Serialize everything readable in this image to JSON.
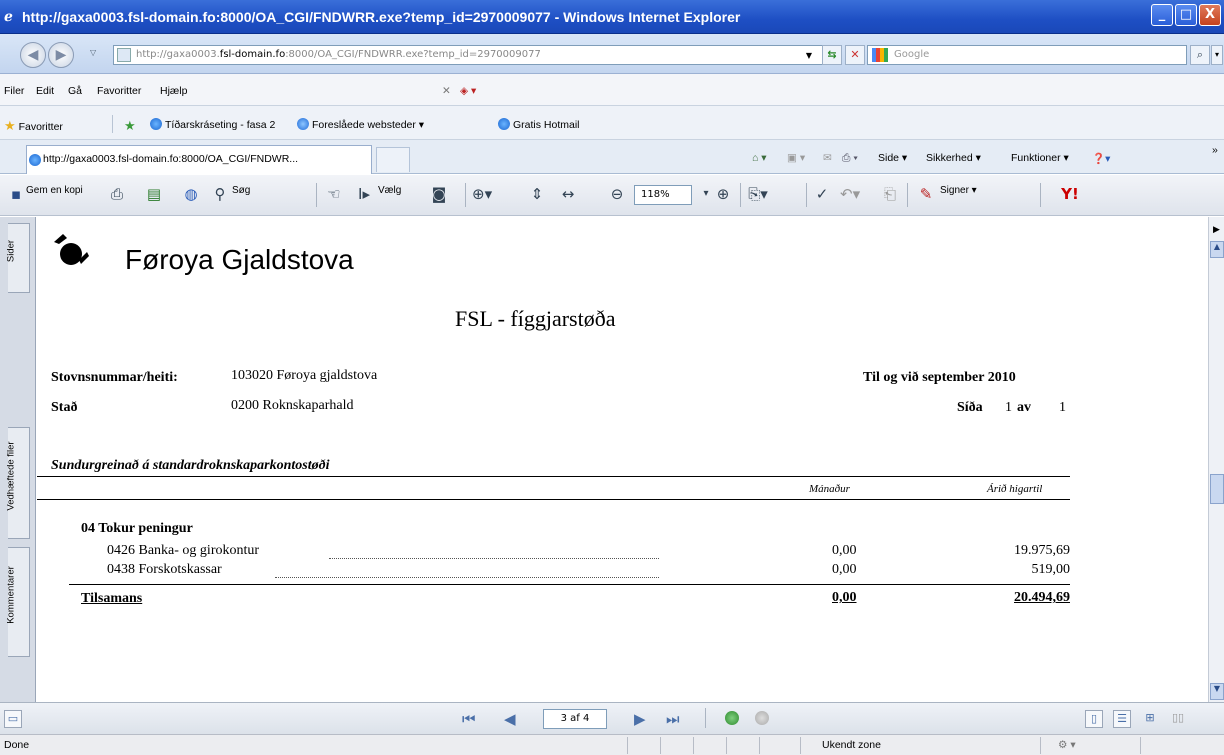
{
  "window": {
    "title": "http://gaxa0003.fsl-domain.fo:8000/OA_CGI/FNDWRR.exe?temp_id=2970009077 - Windows Internet Explorer",
    "controls": {
      "minimize": "_",
      "maximize": "□",
      "close": "X"
    }
  },
  "address": {
    "prefix": "http://gaxa0003.",
    "host": "fsl-domain.fo",
    "suffix": ":8000/OA_CGI/FNDWRR.exe?temp_id=2970009077",
    "search_placeholder": "Google"
  },
  "menu": [
    "Filer",
    "Edit",
    "Gå",
    "Favoritter",
    "Hjælp"
  ],
  "favorites": {
    "label": "Favoritter",
    "items": [
      "Tíðarskráseting - fasa 2",
      "Foreslåede websteder ▾",
      "Gratis Hotmail"
    ]
  },
  "tab": {
    "label": "http://gaxa0003.fsl-domain.fo:8000/OA_CGI/FNDWR...",
    "commands": [
      "Side ▾",
      "Sikkerhed ▾",
      "Funktioner ▾"
    ]
  },
  "acrobat": {
    "save_copy": "Gem en kopi",
    "search": "Søg",
    "select": "Vælg",
    "zoom": "118%",
    "sign": "Signer ▾"
  },
  "sidepanel": [
    "Sider",
    "Vedhæftede filer",
    "Kommentarer"
  ],
  "report": {
    "org_name": "Føroya Gjaldstova",
    "title": "FSL - fíggjarstøða",
    "stovn_label": "Stovnsnummar/heiti:",
    "stovn_value": "103020  Føroya gjaldstova",
    "period": "Til og við september 2010",
    "stad_label": "Stað",
    "stad_value": "0200  Roknskaparhald",
    "page_label": "Síða",
    "page_num": "1",
    "page_of": "av",
    "page_total": "1",
    "section_heading": "Sundurgreinað á standardroknskaparkontostøði",
    "col_month": "Mánaður",
    "col_ytd": "Árið higartil",
    "group_title": "04  Tokur peningur",
    "rows": [
      {
        "label": "0426  Banka- og girokontur",
        "month": "0,00",
        "ytd": "19.975,69"
      },
      {
        "label": "0438  Forskotskassar",
        "month": "0,00",
        "ytd": "519,00"
      }
    ],
    "total_label": "Tilsamans",
    "total_month": "0,00",
    "total_ytd": "20.494,69"
  },
  "pagenav": {
    "page_box": "3 af 4"
  },
  "status": {
    "left": "Done",
    "zone": "Ukendt zone"
  }
}
